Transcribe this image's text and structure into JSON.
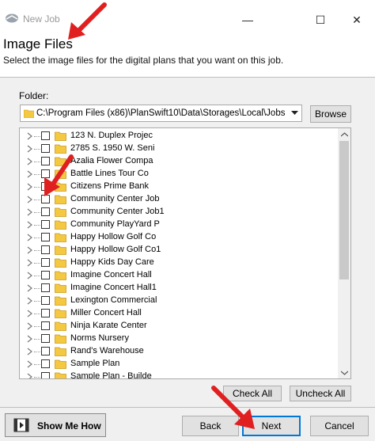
{
  "window": {
    "title": "New Job",
    "minimize_glyph": "—",
    "maximize_glyph": "☐",
    "close_glyph": "✕"
  },
  "header": {
    "title": "Image Files",
    "subtitle": "Select the image files for the digital plans that you want on this job."
  },
  "folder": {
    "label": "Folder:",
    "path": "C:\\Program Files (x86)\\PlanSwift10\\Data\\Storages\\Local\\Jobs",
    "browse_label": "Browse"
  },
  "tree": {
    "items": [
      {
        "label": "123 N. Duplex Projec"
      },
      {
        "label": "2785 S. 1950 W. Seni"
      },
      {
        "label": "Azalia Flower Compa"
      },
      {
        "label": "Battle Lines Tour Co"
      },
      {
        "label": "Citizens Prime Bank"
      },
      {
        "label": "Community Center Job"
      },
      {
        "label": "Community Center Job1"
      },
      {
        "label": "Community PlayYard P"
      },
      {
        "label": "Happy Hollow Golf Co"
      },
      {
        "label": "Happy Hollow Golf Co1"
      },
      {
        "label": "Happy Kids Day Care"
      },
      {
        "label": "Imagine Concert Hall"
      },
      {
        "label": "Imagine Concert Hall1"
      },
      {
        "label": "Lexington Commercial"
      },
      {
        "label": "Miller Concert Hall"
      },
      {
        "label": "Ninja Karate Center"
      },
      {
        "label": "Norms Nursery"
      },
      {
        "label": "Rand's Warehouse"
      },
      {
        "label": "Sample Plan"
      },
      {
        "label": "Sample Plan - Builde"
      }
    ]
  },
  "actions": {
    "check_all": "Check All",
    "uncheck_all": "Uncheck All"
  },
  "footer": {
    "show_me_how": "Show Me How",
    "back": "Back",
    "next": "Next",
    "cancel": "Cancel"
  },
  "colors": {
    "annotation_arrow": "#e02020",
    "folder_yellow": "#f5c842",
    "next_border": "#0078d7"
  }
}
